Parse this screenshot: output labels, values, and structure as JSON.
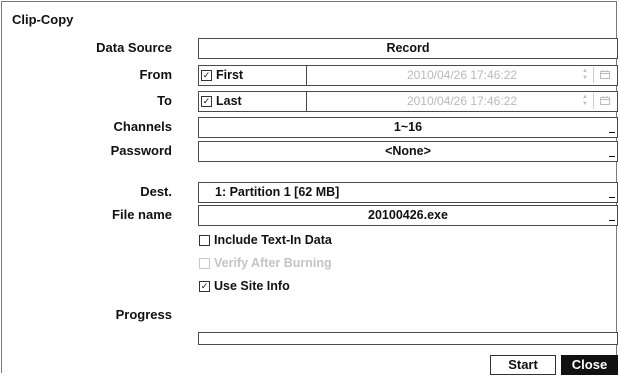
{
  "dialog": {
    "title": "Clip-Copy"
  },
  "fields": {
    "data_source": {
      "label": "Data Source",
      "value": "Record"
    },
    "from": {
      "label": "From",
      "check_label": "First",
      "checked": true,
      "datetime": "2010/04/26  17:46:22"
    },
    "to": {
      "label": "To",
      "check_label": "Last",
      "checked": true,
      "datetime": "2010/04/26  17:46:22"
    },
    "channels": {
      "label": "Channels",
      "value": "1~16"
    },
    "password": {
      "label": "Password",
      "value": "<None>"
    },
    "dest": {
      "label": "Dest.",
      "value": "1: Partition 1 [62 MB]"
    },
    "file_name": {
      "label": "File name",
      "value": "20100426.exe"
    },
    "progress": {
      "label": "Progress",
      "value": 0
    }
  },
  "options": {
    "include_text_in": {
      "label": "Include Text-In Data",
      "checked": false,
      "enabled": true
    },
    "verify_after_burning": {
      "label": "Verify After Burning",
      "checked": false,
      "enabled": false
    },
    "use_site_info": {
      "label": "Use Site Info",
      "checked": true,
      "enabled": true
    }
  },
  "buttons": {
    "start": "Start",
    "close": "Close"
  },
  "icons": {
    "check": "check-icon",
    "calendar": "calendar-icon",
    "spinner": "spinner-icon"
  }
}
